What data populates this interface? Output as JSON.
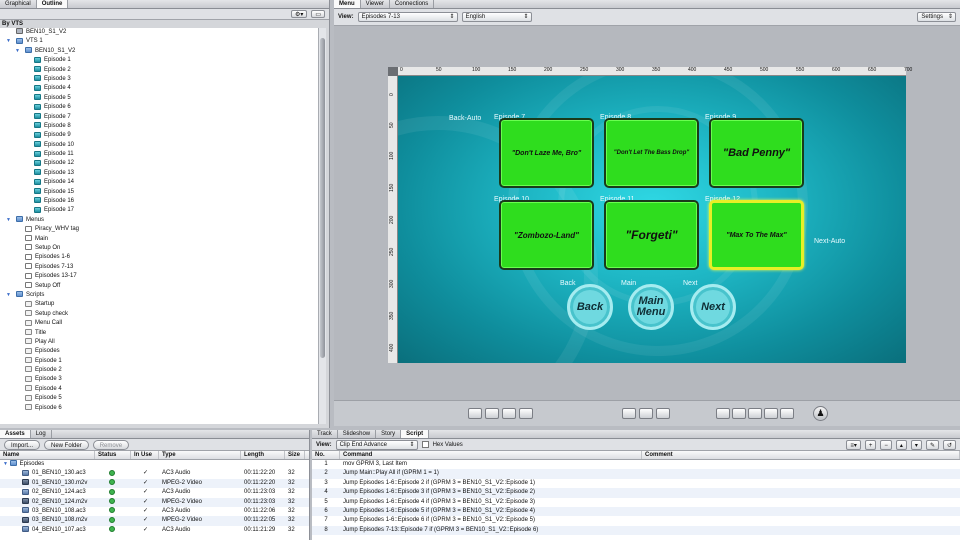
{
  "left_tabs": [
    "Graphical",
    "Outline"
  ],
  "left_header": "By VTS",
  "tree": [
    {
      "label": "BEN10_S1_V2",
      "indent": 0,
      "icon": "disc",
      "tri": ""
    },
    {
      "label": "VTS 1",
      "indent": 0,
      "icon": "folder",
      "tri": "▼"
    },
    {
      "label": "BEN10_S1_V2",
      "indent": 1,
      "icon": "folder",
      "tri": "▼"
    },
    {
      "label": "Episode 1",
      "indent": 2,
      "icon": "episode",
      "tri": ""
    },
    {
      "label": "Episode 2",
      "indent": 2,
      "icon": "episode",
      "tri": ""
    },
    {
      "label": "Episode 3",
      "indent": 2,
      "icon": "episode",
      "tri": ""
    },
    {
      "label": "Episode 4",
      "indent": 2,
      "icon": "episode",
      "tri": ""
    },
    {
      "label": "Episode 5",
      "indent": 2,
      "icon": "episode",
      "tri": ""
    },
    {
      "label": "Episode 6",
      "indent": 2,
      "icon": "episode",
      "tri": ""
    },
    {
      "label": "Episode 7",
      "indent": 2,
      "icon": "episode",
      "tri": ""
    },
    {
      "label": "Episode 8",
      "indent": 2,
      "icon": "episode",
      "tri": ""
    },
    {
      "label": "Episode 9",
      "indent": 2,
      "icon": "episode",
      "tri": ""
    },
    {
      "label": "Episode 10",
      "indent": 2,
      "icon": "episode",
      "tri": ""
    },
    {
      "label": "Episode 11",
      "indent": 2,
      "icon": "episode",
      "tri": ""
    },
    {
      "label": "Episode 12",
      "indent": 2,
      "icon": "episode",
      "tri": ""
    },
    {
      "label": "Episode 13",
      "indent": 2,
      "icon": "episode",
      "tri": ""
    },
    {
      "label": "Episode 14",
      "indent": 2,
      "icon": "episode",
      "tri": ""
    },
    {
      "label": "Episode 15",
      "indent": 2,
      "icon": "episode",
      "tri": ""
    },
    {
      "label": "Episode 16",
      "indent": 2,
      "icon": "episode",
      "tri": ""
    },
    {
      "label": "Episode 17",
      "indent": 2,
      "icon": "episode",
      "tri": ""
    },
    {
      "label": "Menus",
      "indent": 0,
      "icon": "folder",
      "tri": "▼"
    },
    {
      "label": "Piracy_WHV tag",
      "indent": 1,
      "icon": "menu",
      "tri": ""
    },
    {
      "label": "Main",
      "indent": 1,
      "icon": "menu",
      "tri": ""
    },
    {
      "label": "Setup On",
      "indent": 1,
      "icon": "menu",
      "tri": ""
    },
    {
      "label": "Episodes 1-6",
      "indent": 1,
      "icon": "menu",
      "tri": ""
    },
    {
      "label": "Episodes 7-13",
      "indent": 1,
      "icon": "menu",
      "tri": ""
    },
    {
      "label": "Episodes 13-17",
      "indent": 1,
      "icon": "menu",
      "tri": ""
    },
    {
      "label": "Setup Off",
      "indent": 1,
      "icon": "menu",
      "tri": ""
    },
    {
      "label": "Scripts",
      "indent": 0,
      "icon": "folder",
      "tri": "▼"
    },
    {
      "label": "Startup",
      "indent": 1,
      "icon": "script",
      "tri": ""
    },
    {
      "label": "Setup check",
      "indent": 1,
      "icon": "script",
      "tri": ""
    },
    {
      "label": "Menu Call",
      "indent": 1,
      "icon": "script",
      "tri": ""
    },
    {
      "label": "Title",
      "indent": 1,
      "icon": "script",
      "tri": ""
    },
    {
      "label": "Play All",
      "indent": 1,
      "icon": "script",
      "tri": ""
    },
    {
      "label": "Episodes",
      "indent": 1,
      "icon": "script",
      "tri": ""
    },
    {
      "label": "Episode 1",
      "indent": 1,
      "icon": "script",
      "tri": ""
    },
    {
      "label": "Episode 2",
      "indent": 1,
      "icon": "script",
      "tri": ""
    },
    {
      "label": "Episode 3",
      "indent": 1,
      "icon": "script",
      "tri": ""
    },
    {
      "label": "Episode 4",
      "indent": 1,
      "icon": "script",
      "tri": ""
    },
    {
      "label": "Episode 5",
      "indent": 1,
      "icon": "script",
      "tri": ""
    },
    {
      "label": "Episode 6",
      "indent": 1,
      "icon": "script",
      "tri": ""
    }
  ],
  "assets": {
    "tabs": [
      "Assets",
      "Log"
    ],
    "import_label": "Import...",
    "new_folder_label": "New Folder",
    "remove_label": "Remove",
    "columns": [
      "Name",
      "Status",
      "In Use",
      "Type",
      "Length",
      "Size"
    ],
    "folder": "Episodes",
    "rows": [
      {
        "name": "01_BEN10_130.ac3",
        "inuse": "✓",
        "type": "AC3 Audio",
        "length": "00:11:22:20",
        "size": "32",
        "icon": "audio"
      },
      {
        "name": "01_BEN10_130.m2v",
        "inuse": "✓",
        "type": "MPEG-2 Video",
        "length": "00:11:22:20",
        "size": "32",
        "icon": "video"
      },
      {
        "name": "02_BEN10_124.ac3",
        "inuse": "✓",
        "type": "AC3 Audio",
        "length": "00:11:23:03",
        "size": "32",
        "icon": "audio"
      },
      {
        "name": "02_BEN10_124.m2v",
        "inuse": "✓",
        "type": "MPEG-2 Video",
        "length": "00:11:23:03",
        "size": "32",
        "icon": "video"
      },
      {
        "name": "03_BEN10_108.ac3",
        "inuse": "✓",
        "type": "AC3 Audio",
        "length": "00:11:22:06",
        "size": "32",
        "icon": "audio"
      },
      {
        "name": "03_BEN10_108.m2v",
        "inuse": "✓",
        "type": "MPEG-2 Video",
        "length": "00:11:22:05",
        "size": "32",
        "icon": "video"
      },
      {
        "name": "04_BEN10_107.ac3",
        "inuse": "✓",
        "type": "AC3 Audio",
        "length": "00:11:21:29",
        "size": "32",
        "icon": "audio"
      }
    ]
  },
  "center_tabs": [
    "Menu",
    "Viewer",
    "Connections"
  ],
  "view_label": "View:",
  "view_value": "Episodes 7-13",
  "lang_value": "English",
  "settings_label": "Settings",
  "ruler_h": [
    "0",
    "50",
    "100",
    "150",
    "200",
    "250",
    "300",
    "350",
    "400",
    "450",
    "500",
    "550",
    "600",
    "650",
    "700"
  ],
  "ruler_v": [
    "0",
    "50",
    "100",
    "150",
    "200",
    "250",
    "300",
    "350",
    "400"
  ],
  "menu": {
    "back_auto": "Back-Auto",
    "next_auto": "Next-Auto",
    "episodes": [
      {
        "label": "Episode 7",
        "title": "\"Don't Laze Me, Bro\""
      },
      {
        "label": "Episode 8",
        "title": "\"Don't Let The Bass Drop\""
      },
      {
        "label": "Episode 9",
        "title": "\"Bad Penny\""
      },
      {
        "label": "Episode 10",
        "title": "\"Zombozo-Land\""
      },
      {
        "label": "Episode 11",
        "title": "\"Forgeti\""
      },
      {
        "label": "Episode 12",
        "title": "\"Max To The Max\""
      }
    ],
    "nav": [
      {
        "label": "Back",
        "text": "Back"
      },
      {
        "label": "Main",
        "text": "Main Menu"
      },
      {
        "label": "Next",
        "text": "Next"
      }
    ]
  },
  "script": {
    "tabs": [
      "Track",
      "Slideshow",
      "Story",
      "Script"
    ],
    "view_label": "View:",
    "view_value": "Clip End Advance",
    "hex_label": "Hex Values",
    "columns": [
      "No.",
      "Command",
      "Comment"
    ],
    "rows": [
      {
        "no": "1",
        "cmd": "mov GPRM 3, Last Item"
      },
      {
        "no": "2",
        "cmd": "Jump Main::Play All if (GPRM 1 = 1)"
      },
      {
        "no": "3",
        "cmd": "Jump Episodes 1-6::Episode 2 if (GPRM 3 = BEN10_S1_V2::Episode 1)"
      },
      {
        "no": "4",
        "cmd": "Jump Episodes 1-6::Episode 3 if (GPRM 3 = BEN10_S1_V2::Episode 2)"
      },
      {
        "no": "5",
        "cmd": "Jump Episodes 1-6::Episode 4 if (GPRM 3 = BEN10_S1_V2::Episode 3)"
      },
      {
        "no": "6",
        "cmd": "Jump Episodes 1-6::Episode 5 if (GPRM 3 = BEN10_S1_V2::Episode 4)"
      },
      {
        "no": "7",
        "cmd": "Jump Episodes 1-6::Episode 6 if (GPRM 3 = BEN10_S1_V2::Episode 5)"
      },
      {
        "no": "8",
        "cmd": "Jump Episodes 7-13::Episode 7 if (GPRM 3 = BEN10_S1_V2::Episode 6)"
      }
    ]
  }
}
